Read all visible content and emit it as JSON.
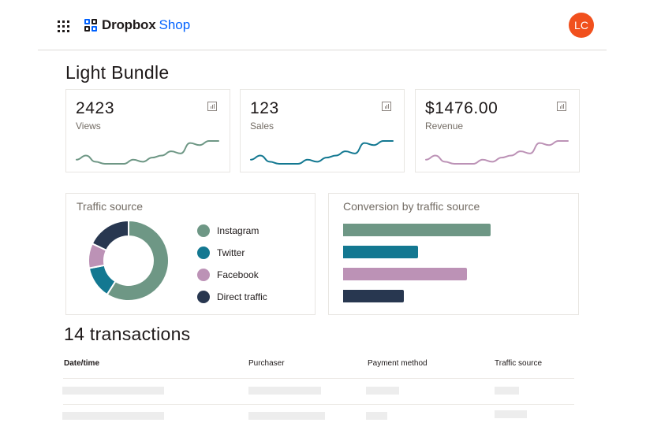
{
  "header": {
    "apps_icon": "grid-icon",
    "brand_name": "Dropbox",
    "brand_product": "Shop",
    "avatar_initials": "LC",
    "avatar_color": "#f1501d",
    "brand_color": "#0061fe"
  },
  "page": {
    "title": "Light Bundle"
  },
  "stats": [
    {
      "value": "2423",
      "label": "Views",
      "icon": "bar-chart-icon",
      "color": "#6e9785",
      "trend": [
        3,
        5,
        2,
        1,
        1,
        1,
        3,
        2,
        4,
        5,
        7,
        6,
        11,
        10,
        12,
        12
      ]
    },
    {
      "value": "123",
      "label": "Sales",
      "icon": "bar-chart-icon",
      "color": "#137891",
      "trend": [
        3,
        5,
        2,
        1,
        1,
        1,
        3,
        2,
        4,
        5,
        7,
        6,
        11,
        10,
        12,
        12
      ]
    },
    {
      "value": "$1476.00",
      "label": "Revenue",
      "icon": "bar-chart-icon",
      "color": "#bc92b6",
      "trend": [
        3,
        5,
        2,
        1,
        1,
        1,
        3,
        2,
        4,
        5,
        7,
        6,
        11,
        10,
        12,
        12
      ]
    }
  ],
  "traffic": {
    "title": "Traffic source",
    "sources": [
      {
        "name": "Instagram",
        "share": 59,
        "color": "#6e9785"
      },
      {
        "name": "Twitter",
        "share": 13,
        "color": "#137891"
      },
      {
        "name": "Facebook",
        "share": 10,
        "color": "#bc92b6"
      },
      {
        "name": "Direct traffic",
        "share": 18,
        "color": "#283750"
      }
    ]
  },
  "conversion": {
    "title": "Conversion by traffic source",
    "values": [
      {
        "name": "Instagram",
        "value": 100,
        "color": "#6e9785"
      },
      {
        "name": "Twitter",
        "value": 51,
        "color": "#137891"
      },
      {
        "name": "Facebook",
        "value": 84,
        "color": "#bc92b6"
      },
      {
        "name": "Direct traffic",
        "value": 41,
        "color": "#283750"
      }
    ]
  },
  "transactions": {
    "title": "14 transactions",
    "columns": [
      "Date/time",
      "Purchaser",
      "Payment method",
      "Traffic source"
    ]
  }
}
